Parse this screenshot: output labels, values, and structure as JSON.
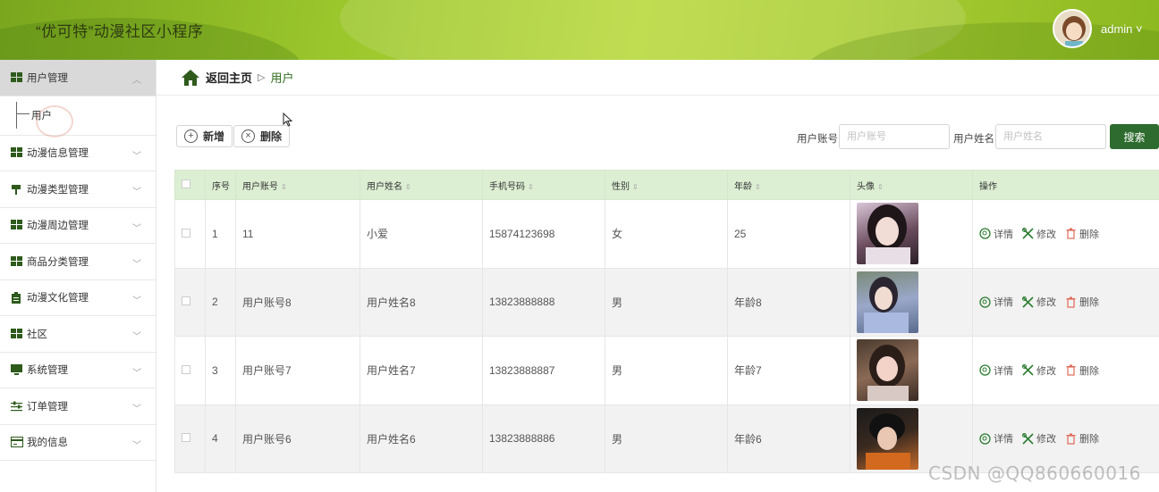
{
  "header": {
    "app_title": "“优可特”动漫社区小程序",
    "user": "admin ˅"
  },
  "sidebar": {
    "items": [
      {
        "label": "用户管理",
        "icon": "grid-icon"
      },
      {
        "label": "动漫信息管理",
        "icon": "grid-icon"
      },
      {
        "label": "动漫类型管理",
        "icon": "pin-icon"
      },
      {
        "label": "动漫周边管理",
        "icon": "grid-icon"
      },
      {
        "label": "商品分类管理",
        "icon": "grid-icon"
      },
      {
        "label": "动漫文化管理",
        "icon": "clipboard-icon"
      },
      {
        "label": "社区",
        "icon": "grid-icon"
      },
      {
        "label": "系统管理",
        "icon": "monitor-icon"
      },
      {
        "label": "订单管理",
        "icon": "sliders-icon"
      },
      {
        "label": "我的信息",
        "icon": "card-icon"
      }
    ],
    "sub_item": "用户"
  },
  "breadcrumb": {
    "home": "返回主页",
    "sep": "▷",
    "current": "用户"
  },
  "toolbar": {
    "add": "新增",
    "delete": "删除"
  },
  "search": {
    "account_label": "用户账号",
    "account_placeholder": "用户账号",
    "name_label": "用户姓名",
    "name_placeholder": "用户姓名",
    "button": "搜索"
  },
  "table": {
    "headers": [
      "序号",
      "用户账号",
      "用户姓名",
      "手机号码",
      "性别",
      "年龄",
      "头像",
      "操作"
    ],
    "rows": [
      {
        "no": "1",
        "account": "11",
        "name": "小爱",
        "phone": "15874123698",
        "gender": "女",
        "age": "25"
      },
      {
        "no": "2",
        "account": "用户账号8",
        "name": "用户姓名8",
        "phone": "13823888888",
        "gender": "男",
        "age": "年龄8"
      },
      {
        "no": "3",
        "account": "用户账号7",
        "name": "用户姓名7",
        "phone": "13823888887",
        "gender": "男",
        "age": "年龄7"
      },
      {
        "no": "4",
        "account": "用户账号6",
        "name": "用户姓名6",
        "phone": "13823888886",
        "gender": "男",
        "age": "年龄6"
      }
    ],
    "ops": {
      "detail": "详情",
      "edit": "修改",
      "delete": "删除"
    }
  },
  "watermark": "CSDN @QQ860660016",
  "colors": {
    "accent": "#2e6b2e",
    "header_green": "#9cc72c",
    "table_head": "#dcefd3"
  }
}
